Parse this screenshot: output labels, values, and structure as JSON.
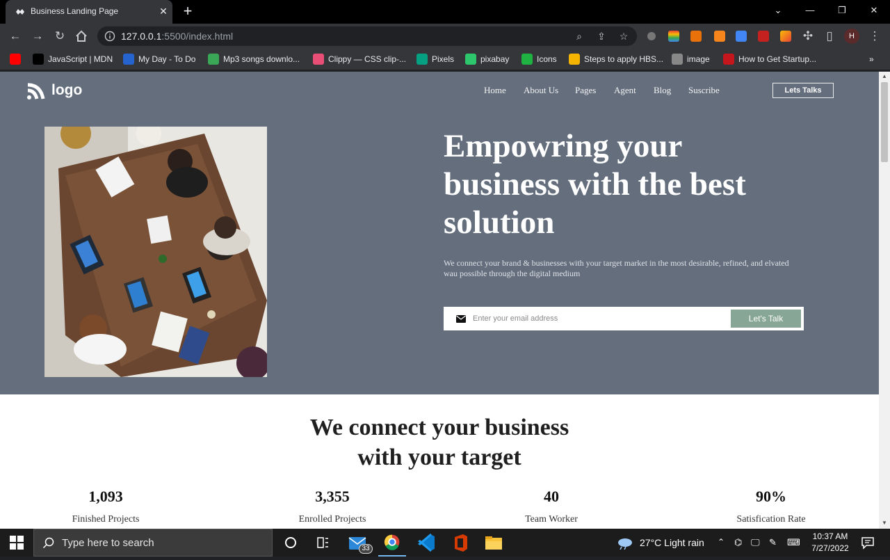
{
  "browser": {
    "tab_title": "Business Landing Page",
    "url_host": "127.0.0.1",
    "url_rest": ":5500/index.html"
  },
  "bookmarks": [
    {
      "label": "",
      "icon": "youtube-icon",
      "color": "#ff0000"
    },
    {
      "label": "JavaScript | MDN",
      "icon": "mdn-icon",
      "color": "#000000"
    },
    {
      "label": "My Day - To Do",
      "icon": "todo-check-icon",
      "color": "#2564cf"
    },
    {
      "label": "Mp3 songs downlo...",
      "icon": "music-icon",
      "color": "#3aa757"
    },
    {
      "label": "Clippy — CSS clip-...",
      "icon": "clippy-icon",
      "color": "#e94e77"
    },
    {
      "label": "Pixels",
      "icon": "pexels-icon",
      "color": "#05a081"
    },
    {
      "label": "pixabay",
      "icon": "pixabay-icon",
      "color": "#2ec66d"
    },
    {
      "label": "Icons",
      "icon": "icons8-icon",
      "color": "#1fb141"
    },
    {
      "label": "Steps to apply HBS...",
      "icon": "hbs-icon",
      "color": "#f4b400"
    },
    {
      "label": "image",
      "icon": "image-icon",
      "color": "#888888"
    },
    {
      "label": "How to Get Startup...",
      "icon": "startup-icon",
      "color": "#c4161c"
    }
  ],
  "site": {
    "logo_text": "logo",
    "nav": [
      "Home",
      "About Us",
      "Pages",
      "Agent",
      "Blog",
      "Suscribe"
    ],
    "cta_top": "Lets Talks",
    "hero_title": "Empowring your business with the best solution",
    "hero_subtitle": "We connect your brand & businesses with your target market in the most desirable, refined, and elvated wau possible through the digital medium",
    "email_placeholder": "Enter your email address",
    "email_button": "Let's Talk",
    "section_title_line1": "We connect your business",
    "section_title_line2": "with your target",
    "stats": [
      {
        "value": "1,093",
        "label": "Finished Projects"
      },
      {
        "value": "3,355",
        "label": "Enrolled Projects"
      },
      {
        "value": "40",
        "label": "Team Worker"
      },
      {
        "value": "90%",
        "label": "Satisfication Rate"
      }
    ],
    "colors": {
      "hero_bg": "#646e7d",
      "button_green": "#88a696"
    }
  },
  "taskbar": {
    "search_placeholder": "Type here to search",
    "mail_badge": "33",
    "weather": "27°C  Light rain",
    "time": "10:37 AM",
    "date": "7/27/2022"
  }
}
